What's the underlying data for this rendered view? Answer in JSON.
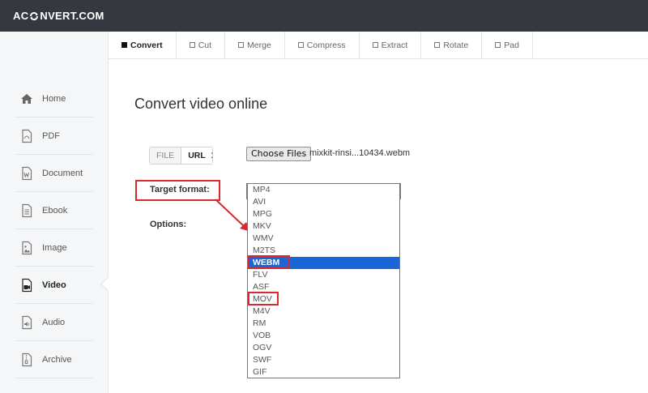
{
  "header": {
    "logo_left": "AC",
    "logo_right": "NVERT.COM"
  },
  "sidebar": {
    "items": [
      {
        "label": "Home",
        "icon": "home-icon"
      },
      {
        "label": "PDF",
        "icon": "pdf-icon"
      },
      {
        "label": "Document",
        "icon": "document-icon"
      },
      {
        "label": "Ebook",
        "icon": "ebook-icon"
      },
      {
        "label": "Image",
        "icon": "image-icon"
      },
      {
        "label": "Video",
        "icon": "video-icon",
        "active": true
      },
      {
        "label": "Audio",
        "icon": "audio-icon"
      },
      {
        "label": "Archive",
        "icon": "archive-icon"
      }
    ]
  },
  "tabs": [
    {
      "label": "Convert",
      "active": true
    },
    {
      "label": "Cut"
    },
    {
      "label": "Merge"
    },
    {
      "label": "Compress"
    },
    {
      "label": "Extract"
    },
    {
      "label": "Rotate"
    },
    {
      "label": "Pad"
    }
  ],
  "main": {
    "title": "Convert video online",
    "source": {
      "file_label": "FILE",
      "url_label": "URL",
      "colon": ":"
    },
    "choose_button": "Choose Files",
    "file_name": "mixkit-rinsi...10434.webm",
    "target_format_label": "Target format:",
    "options_label": "Options:",
    "formats": [
      "MP4",
      "AVI",
      "MPG",
      "MKV",
      "WMV",
      "M2TS",
      "WEBM",
      "FLV",
      "ASF",
      "MOV",
      "M4V",
      "RM",
      "VOB",
      "OGV",
      "SWF",
      "GIF"
    ],
    "selected_format": "WEBM"
  },
  "colors": {
    "topbar": "#35393f",
    "selected": "#1a66d6",
    "highlight": "#d9282f"
  }
}
